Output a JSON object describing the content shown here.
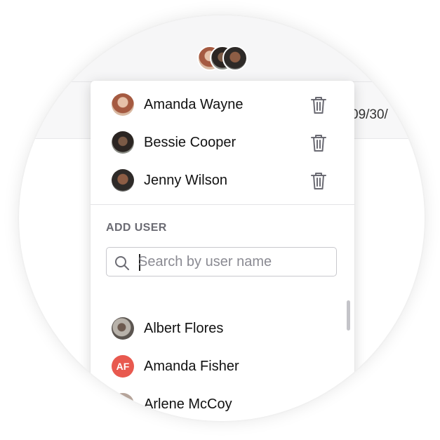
{
  "background": {
    "date_fragment": "09/30/"
  },
  "members": [
    {
      "name": "Amanda Wayne",
      "avatar": "photo-avatar"
    },
    {
      "name": "Bessie Cooper",
      "avatar": "photo-avatar"
    },
    {
      "name": "Jenny Wilson",
      "avatar": "photo-avatar"
    }
  ],
  "add_user": {
    "label": "ADD USER",
    "search_placeholder": "Search by user name",
    "search_value": ""
  },
  "suggestions": [
    {
      "name": "Albert Flores",
      "avatar": "photo-avatar"
    },
    {
      "name": "Amanda Fisher",
      "initials": "AF",
      "avatar_color": "#e8594f"
    },
    {
      "name": "Arlene McCoy",
      "avatar": "photo-avatar"
    }
  ],
  "icons": {
    "remove": "trash-icon",
    "search": "search-icon"
  },
  "colors": {
    "initials_avatar": "#e8594f",
    "label_text": "#6b6b73"
  }
}
